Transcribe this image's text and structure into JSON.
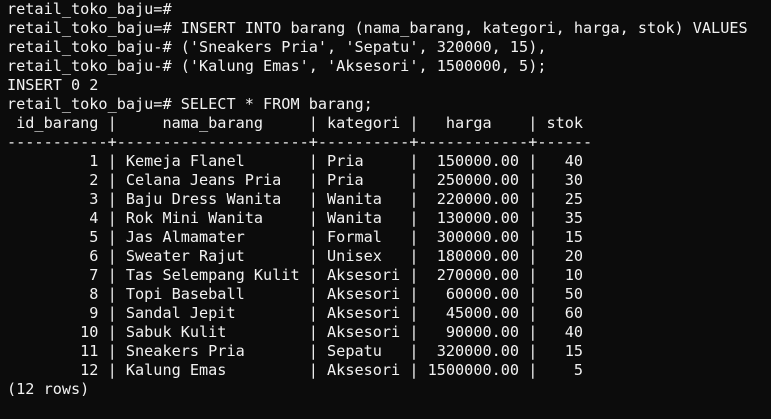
{
  "terminal": {
    "lines": [
      "retail_toko_baju=#",
      "retail_toko_baju=# INSERT INTO barang (nama_barang, kategori, harga, stok) VALUES",
      "retail_toko_baju-# ('Sneakers Pria', 'Sepatu', 320000, 15),",
      "retail_toko_baju-# ('Kalung Emas', 'Aksesori', 1500000, 5);",
      "INSERT 0 2",
      "retail_toko_baju=# SELECT * FROM barang;",
      " id_barang |     nama_barang     | kategori |   harga    | stok",
      "-----------+---------------------+----------+------------+------",
      "         1 | Kemeja Flanel       | Pria     |  150000.00 |   40",
      "         2 | Celana Jeans Pria   | Pria     |  250000.00 |   30",
      "         3 | Baju Dress Wanita   | Wanita   |  220000.00 |   25",
      "         4 | Rok Mini Wanita     | Wanita   |  130000.00 |   35",
      "         5 | Jas Almamater       | Formal   |  300000.00 |   15",
      "         6 | Sweater Rajut       | Unisex   |  180000.00 |   20",
      "         7 | Tas Selempang Kulit | Aksesori |  270000.00 |   10",
      "         8 | Topi Baseball       | Aksesori |   60000.00 |   50",
      "         9 | Sandal Jepit        | Aksesori |   45000.00 |   60",
      "        10 | Sabuk Kulit         | Aksesori |   90000.00 |   40",
      "        11 | Sneakers Pria       | Sepatu   |  320000.00 |   15",
      "        12 | Kalung Emas         | Aksesori | 1500000.00 |    5",
      "(12 rows)"
    ]
  }
}
